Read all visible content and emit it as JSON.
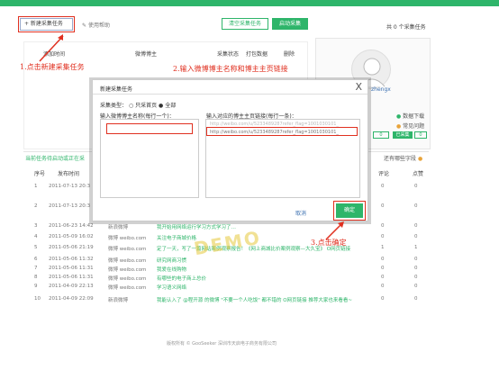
{
  "toolbar": {
    "new_task": "+ 新建采集任务",
    "help": "使用帮助",
    "clear": "清空采集任务",
    "start": "启动采集",
    "task_total": "共 0 个采集任务"
  },
  "top_table": {
    "headers": [
      "添加时间",
      "微博博主",
      "采集状态",
      "打包数据",
      "删除"
    ]
  },
  "profile": {
    "name": "zhengx",
    "options": [
      "数据下载",
      "常见问题"
    ],
    "badge1": "0",
    "badge2": "已采集",
    "badge3": "0"
  },
  "annotations": {
    "step1": "1.点击新建采集任务",
    "step2": "2.输入微博博主名称和博主主页链接",
    "step3": "3.点击确定"
  },
  "status_line": {
    "left": "当前任务待启动或正在采",
    "right": "还有哪些字段"
  },
  "dialog": {
    "title": "新建采集任务",
    "close": "X",
    "type_label": "采集类型：",
    "radio_original": "只采首页",
    "radio_all": "全部",
    "name_label": "输入微博博主名称(每行一个)：",
    "url_label": "输入对应的博主主页链接(每行一条)：",
    "url_hint": "http://weibo.com/u/5233489287refer_flag=1001030101_",
    "url_value": "http://weibo.com/u/5233489287refer_flag=1001030101_",
    "cancel": "取消",
    "ok": "确定"
  },
  "watermark": "DEMO",
  "main_table": {
    "headers": [
      "序号",
      "发布时间",
      "评论",
      "点赞"
    ],
    "rows": [
      {
        "idx": "1",
        "date": "2011-07-13 20:3",
        "source": "",
        "content": "",
        "comment": "0",
        "like": "0"
      },
      {
        "idx": "2",
        "date": "2011-07-13 20:3",
        "source": "",
        "content": "",
        "comment": "0",
        "like": "0"
      },
      {
        "idx": "3",
        "date": "2011-06-23 14:42",
        "source": "新浪微博",
        "content": "我开始用网络运行学习方式学习了…",
        "comment": "0",
        "like": "0"
      },
      {
        "idx": "4",
        "date": "2011-05-09 16:02",
        "source": "微博 weibo.com",
        "content": "关注电子商城价格",
        "comment": "0",
        "like": "0"
      },
      {
        "idx": "5",
        "date": "2011-05-06 21:19",
        "source": "微博 weibo.com",
        "content": "定了一天，写了一篇网站案例观察报告！《网上商城比价案例观察—大久宝》 O网页链接",
        "comment": "1",
        "like": "1"
      },
      {
        "idx": "6",
        "date": "2011-05-06 11:32",
        "source": "微博 weibo.com",
        "content": "研究网商习惯",
        "comment": "0",
        "like": "0"
      },
      {
        "idx": "7",
        "date": "2011-05-06 11:31",
        "source": "微博 weibo.com",
        "content": "我爱在线购物",
        "comment": "0",
        "like": "0"
      },
      {
        "idx": "8",
        "date": "2011-05-06 11:31",
        "source": "微博 weibo.com",
        "content": "有哪些的电子商上总价",
        "comment": "0",
        "like": "0"
      },
      {
        "idx": "9",
        "date": "2011-04-09 22:13",
        "source": "微博 weibo.com",
        "content": "学习语义网络",
        "comment": "0",
        "like": "0"
      },
      {
        "idx": "10",
        "date": "2011-04-09 22:09",
        "source": "新浪微博",
        "content": "我能认入了 @程开源 的微博 \"不要一个人吃饭\" 都不错的 O网页链接 推荐大家也来看看~",
        "comment": "0",
        "like": "0"
      }
    ]
  },
  "footer": "版权所有 © GooSeeker  深圳市天启电子商务有限公司",
  "colors": {
    "accent": "#2eb56a",
    "annotation": "#e03020",
    "link": "#3a6fb0"
  }
}
